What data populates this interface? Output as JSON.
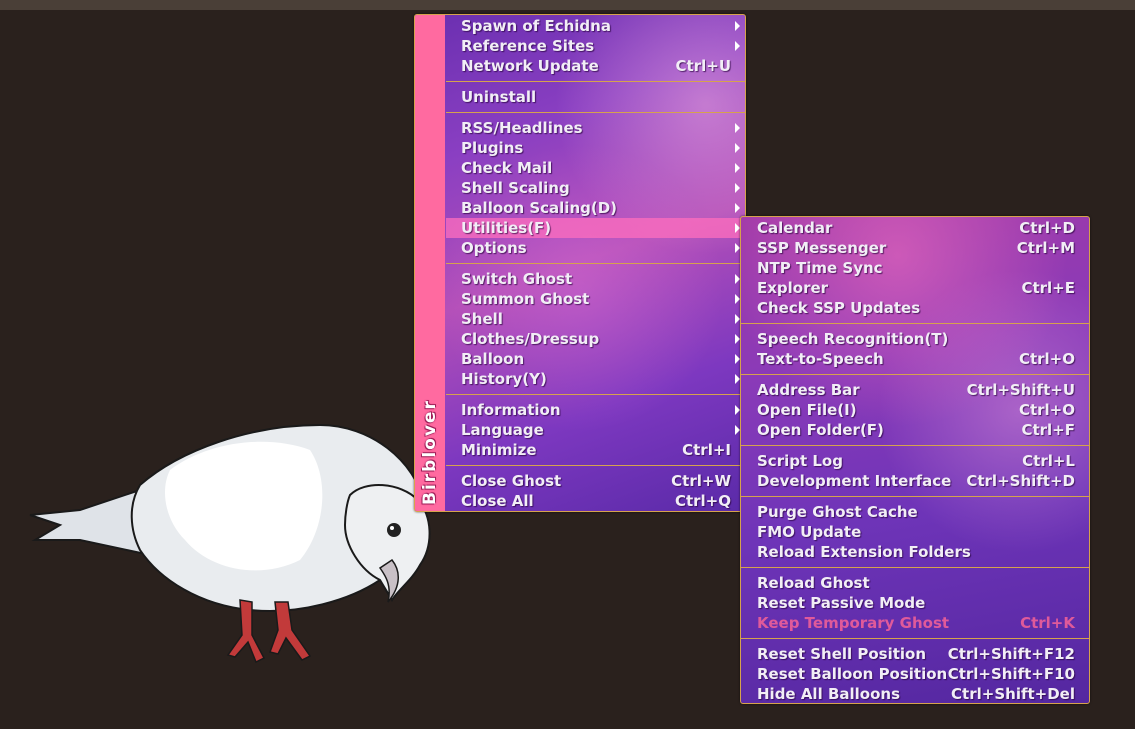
{
  "main_menu": {
    "sidebar_label": "Birblover",
    "groups": [
      [
        {
          "label": "Spawn of Echidna",
          "submenu": true
        },
        {
          "label": "Reference Sites",
          "submenu": true
        },
        {
          "label": "Network Update",
          "shortcut": "Ctrl+U"
        }
      ],
      [
        {
          "label": "Uninstall"
        }
      ],
      [
        {
          "label": "RSS/Headlines",
          "submenu": true
        },
        {
          "label": "Plugins",
          "submenu": true
        },
        {
          "label": "Check Mail",
          "submenu": true
        },
        {
          "label": "Shell Scaling",
          "submenu": true
        },
        {
          "label": "Balloon Scaling(D)",
          "submenu": true
        },
        {
          "label": "Utilities(F)",
          "submenu": true,
          "selected": true
        },
        {
          "label": "Options",
          "submenu": true
        }
      ],
      [
        {
          "label": "Switch Ghost",
          "submenu": true
        },
        {
          "label": "Summon Ghost",
          "submenu": true
        },
        {
          "label": "Shell",
          "submenu": true
        },
        {
          "label": "Clothes/Dressup",
          "submenu": true
        },
        {
          "label": "Balloon",
          "submenu": true
        },
        {
          "label": "History(Y)",
          "submenu": true
        }
      ],
      [
        {
          "label": "Information",
          "submenu": true
        },
        {
          "label": "Language",
          "submenu": true
        },
        {
          "label": "Minimize",
          "shortcut": "Ctrl+I"
        }
      ],
      [
        {
          "label": "Close Ghost",
          "shortcut": "Ctrl+W"
        },
        {
          "label": "Close All",
          "shortcut": "Ctrl+Q"
        }
      ]
    ]
  },
  "utilities_menu": {
    "groups": [
      [
        {
          "label": "Calendar",
          "shortcut": "Ctrl+D"
        },
        {
          "label": "SSP Messenger",
          "shortcut": "Ctrl+M"
        },
        {
          "label": "NTP Time Sync"
        },
        {
          "label": "Explorer",
          "shortcut": "Ctrl+E"
        },
        {
          "label": "Check SSP Updates"
        }
      ],
      [
        {
          "label": "Speech Recognition(T)"
        },
        {
          "label": "Text-to-Speech",
          "shortcut": "Ctrl+O"
        }
      ],
      [
        {
          "label": "Address Bar",
          "shortcut": "Ctrl+Shift+U"
        },
        {
          "label": "Open File(I)",
          "shortcut": "Ctrl+O"
        },
        {
          "label": "Open Folder(F)",
          "shortcut": "Ctrl+F"
        }
      ],
      [
        {
          "label": "Script Log",
          "shortcut": "Ctrl+L"
        },
        {
          "label": "Development Interface",
          "shortcut": "Ctrl+Shift+D"
        }
      ],
      [
        {
          "label": "Purge Ghost Cache"
        },
        {
          "label": "FMO Update"
        },
        {
          "label": "Reload Extension Folders"
        }
      ],
      [
        {
          "label": "Reload Ghost"
        },
        {
          "label": "Reset Passive Mode"
        },
        {
          "label": "Keep Temporary Ghost",
          "shortcut": "Ctrl+K",
          "disabled": true
        }
      ],
      [
        {
          "label": "Reset Shell Position",
          "shortcut": "Ctrl+Shift+F12"
        },
        {
          "label": "Reset Balloon Position",
          "shortcut": "Ctrl+Shift+F10"
        },
        {
          "label": "Hide All Balloons",
          "shortcut": "Ctrl+Shift+Del"
        }
      ]
    ]
  },
  "colors": {
    "background": "#2a211d",
    "sidebar": "#ff6aa0",
    "selected_item": "#ff6ebe",
    "separator": "#d6a24d",
    "disabled_text": "#e05a9a"
  }
}
